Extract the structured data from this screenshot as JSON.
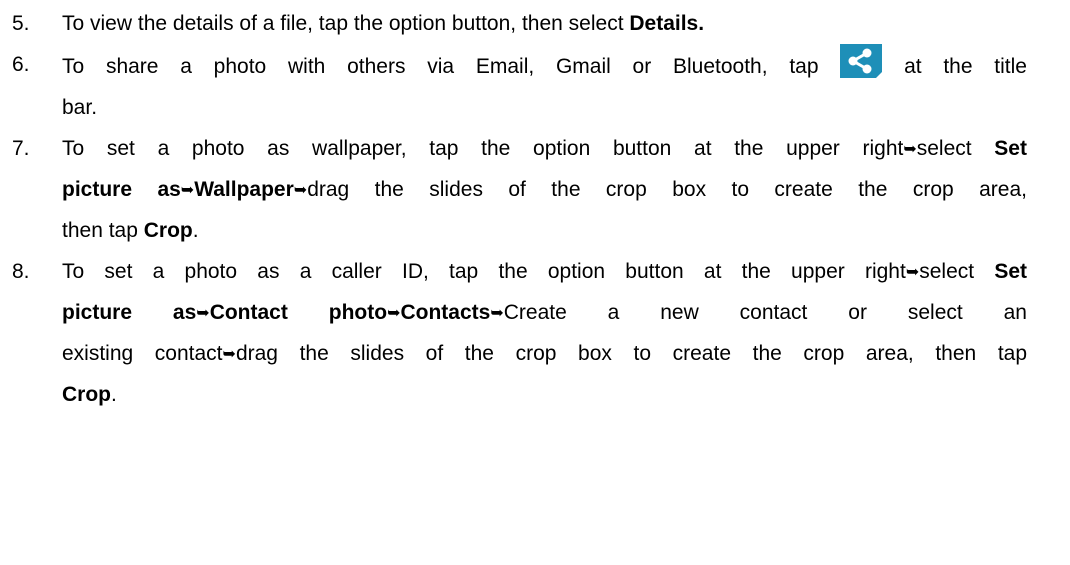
{
  "steps": [
    {
      "number": "5.",
      "lines": [
        {
          "t": "To view the details of a file, tap the option button, then select "
        },
        {
          "b": "Details."
        }
      ]
    },
    {
      "number": "6.",
      "line1_a": "To share a photo with others via Email, Gmail or Bluetooth, tap",
      "icon": "share-icon",
      "line1_b": "at the title",
      "line2": "bar."
    },
    {
      "number": "7.",
      "l1_text": "To set a photo as wallpaper, tap the option button at the upper right",
      "l1_select": "select",
      "l1_bold": "Set",
      "l2_bold1": "picture as",
      "l2_bold2": "Wallpaper",
      "l2_text": "drag the slides of the crop box to create the crop area,",
      "l3_text": "then tap",
      "l3_bold": "Crop",
      "l3_end": "."
    },
    {
      "number": "8.",
      "l1_text": "To set a photo as a caller ID, tap the option button at the upper right",
      "l1_select": "select",
      "l1_bold": "Set",
      "l2_bold1": "picture as",
      "l2_bold2": "Contact photo",
      "l2_bold3": "Contacts",
      "l2_text": "Create a new contact or select an",
      "l3_text1": "existing contact",
      "l3_text2": "drag the slides of the crop box to create the crop area, then tap",
      "l4_bold": "Crop",
      "l4_end": "."
    }
  ],
  "arrow_glyph": "➥",
  "accent_color": "#1e8fb8"
}
